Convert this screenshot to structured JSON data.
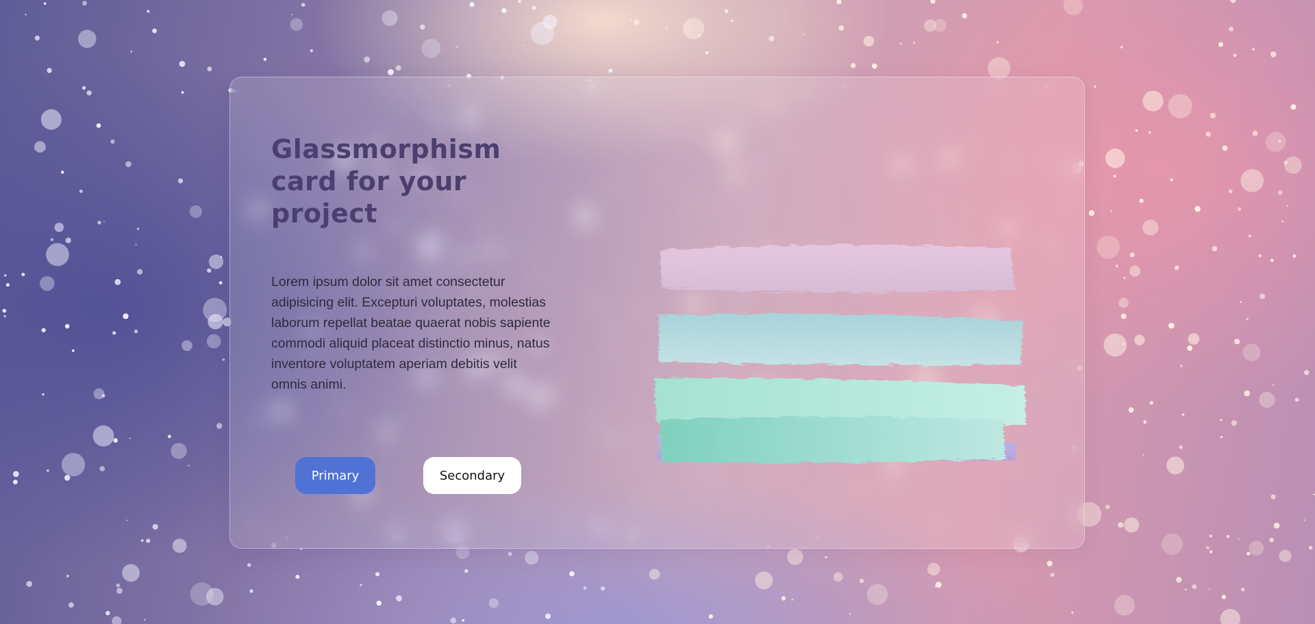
{
  "card": {
    "title": "Glassmorphism card for your project",
    "text": "Lorem ipsum dolor sit amet consectetur adipisicing elit. Excepturi voluptates, molestias laborum repellat beatae quaerat nobis sapiente commodi aliquid placeat distinctio minus, natus inventore voluptatem aperiam debitis velit omnis animi.",
    "primary_label": "Primary",
    "secondary_label": "Secondary"
  },
  "colors": {
    "title": "#4a3f6e",
    "primary_button": "#4f72d4",
    "secondary_button": "#ffffff",
    "stroke_pink": "#dcc0d6",
    "stroke_blue": "#b9dbe0",
    "stroke_mint": "#b4e6d8",
    "stroke_lavender": "#b8a6dc",
    "stroke_teal": "#9fdbcc"
  },
  "icons": {
    "watercolor_strokes": "watercolor-strokes-illustration"
  }
}
